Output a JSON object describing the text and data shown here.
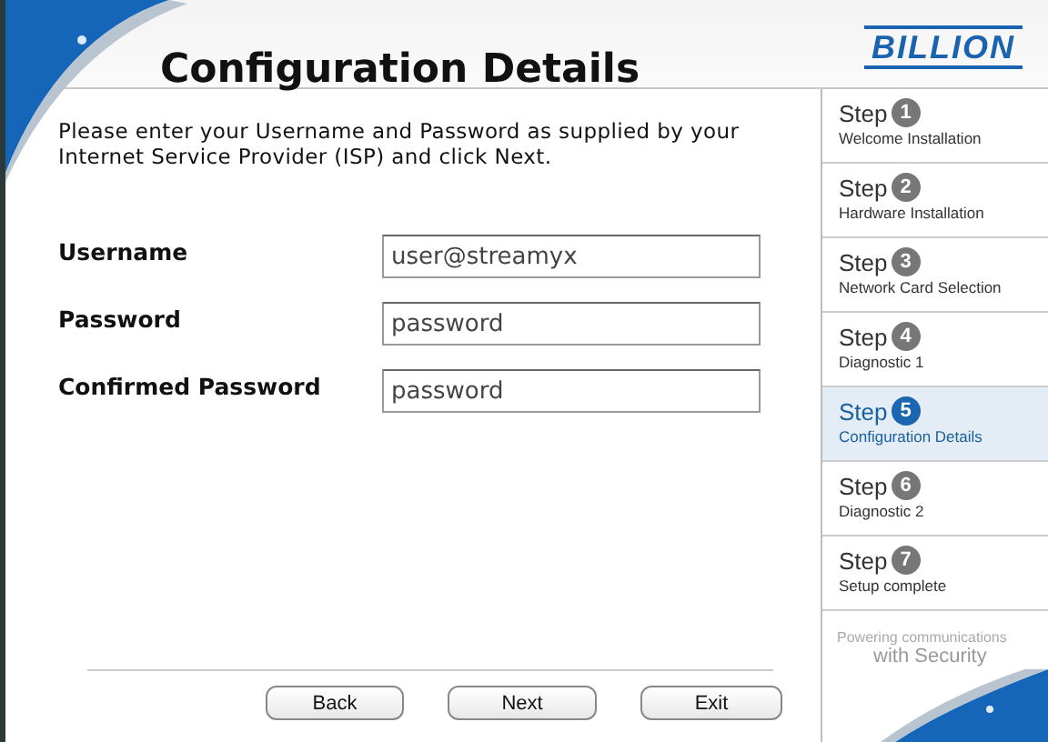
{
  "header": {
    "title": "Configuration Details",
    "logo": "BILLION"
  },
  "instructions": "Please enter your Username and Password as supplied by your Internet Service Provider (ISP) and click Next.",
  "fields": [
    {
      "label": "Username",
      "value": "user@streamyx"
    },
    {
      "label": "Password",
      "value": "password"
    },
    {
      "label": "Confirmed Password",
      "value": "password"
    }
  ],
  "steps": [
    {
      "label": "Step",
      "number": "1",
      "caption": "Welcome Installation",
      "selected": false
    },
    {
      "label": "Step",
      "number": "2",
      "caption": "Hardware Installation",
      "selected": false
    },
    {
      "label": "Step",
      "number": "3",
      "caption": "Network Card Selection",
      "selected": false
    },
    {
      "label": "Step",
      "number": "4",
      "caption": "Diagnostic 1",
      "selected": false
    },
    {
      "label": "Step",
      "number": "5",
      "caption": "Configuration Details",
      "selected": true
    },
    {
      "label": "Step",
      "number": "6",
      "caption": "Diagnostic 2",
      "selected": false
    },
    {
      "label": "Step",
      "number": "7",
      "caption": "Setup complete",
      "selected": false
    }
  ],
  "tagline": {
    "line_1": "Powering communications",
    "line_2": "with Security"
  },
  "buttons": [
    "Back",
    "Next",
    "Exit"
  ]
}
